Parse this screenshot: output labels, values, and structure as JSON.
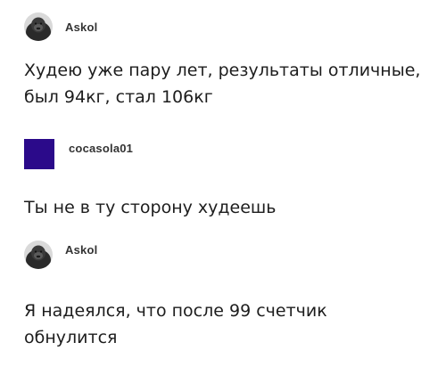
{
  "posts": [
    {
      "username": "Askol",
      "avatar": "gorilla-avatar-icon",
      "text": "Худею уже пару лет, результаты отличные,\nбыл 94кг, стал 106кг"
    },
    {
      "username": "cocasola01",
      "avatar": "purple-square-avatar",
      "avatar_color": "#2b0a8a",
      "text": "Ты не в ту сторону худеешь"
    },
    {
      "username": "Askol",
      "avatar": "gorilla-avatar-icon",
      "text": "Я надеялся, что после 99 счетчик\nобнулится"
    }
  ]
}
